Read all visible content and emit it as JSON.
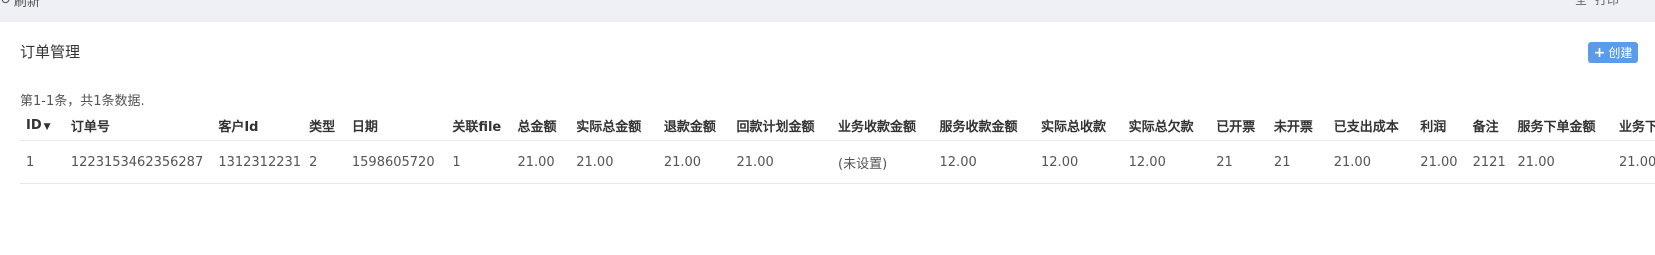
{
  "topbar": {
    "refresh_label": "刷新",
    "right_text_1": "全",
    "right_text_2": "打印"
  },
  "panel": {
    "title": "订单管理",
    "create_button_label": "创建"
  },
  "summary": "第1-1条，共1条数据.",
  "table": {
    "columns": [
      "ID",
      "订单号",
      "客户Id",
      "类型",
      "日期",
      "关联file",
      "总金额",
      "实际总金额",
      "退款金额",
      "回款计划金额",
      "业务收款金额",
      "服务收款金额",
      "实际总收款",
      "实际总欠款",
      "已开票",
      "未开票",
      "已支出成本",
      "利润",
      "备注",
      "服务下单金额",
      "业务下单"
    ],
    "rows": [
      [
        "1",
        "1223153462356287",
        "1312312231",
        "2",
        "1598605720",
        "1",
        "21.00",
        "21.00",
        "21.00",
        "21.00",
        "(未设置)",
        "12.00",
        "12.00",
        "12.00",
        "21",
        "21",
        "21.00",
        "21.00",
        "2121",
        "21.00",
        "21.00"
      ]
    ]
  },
  "colors": {
    "accent": "#5b9bea",
    "header_bg": "#eef0f5"
  }
}
